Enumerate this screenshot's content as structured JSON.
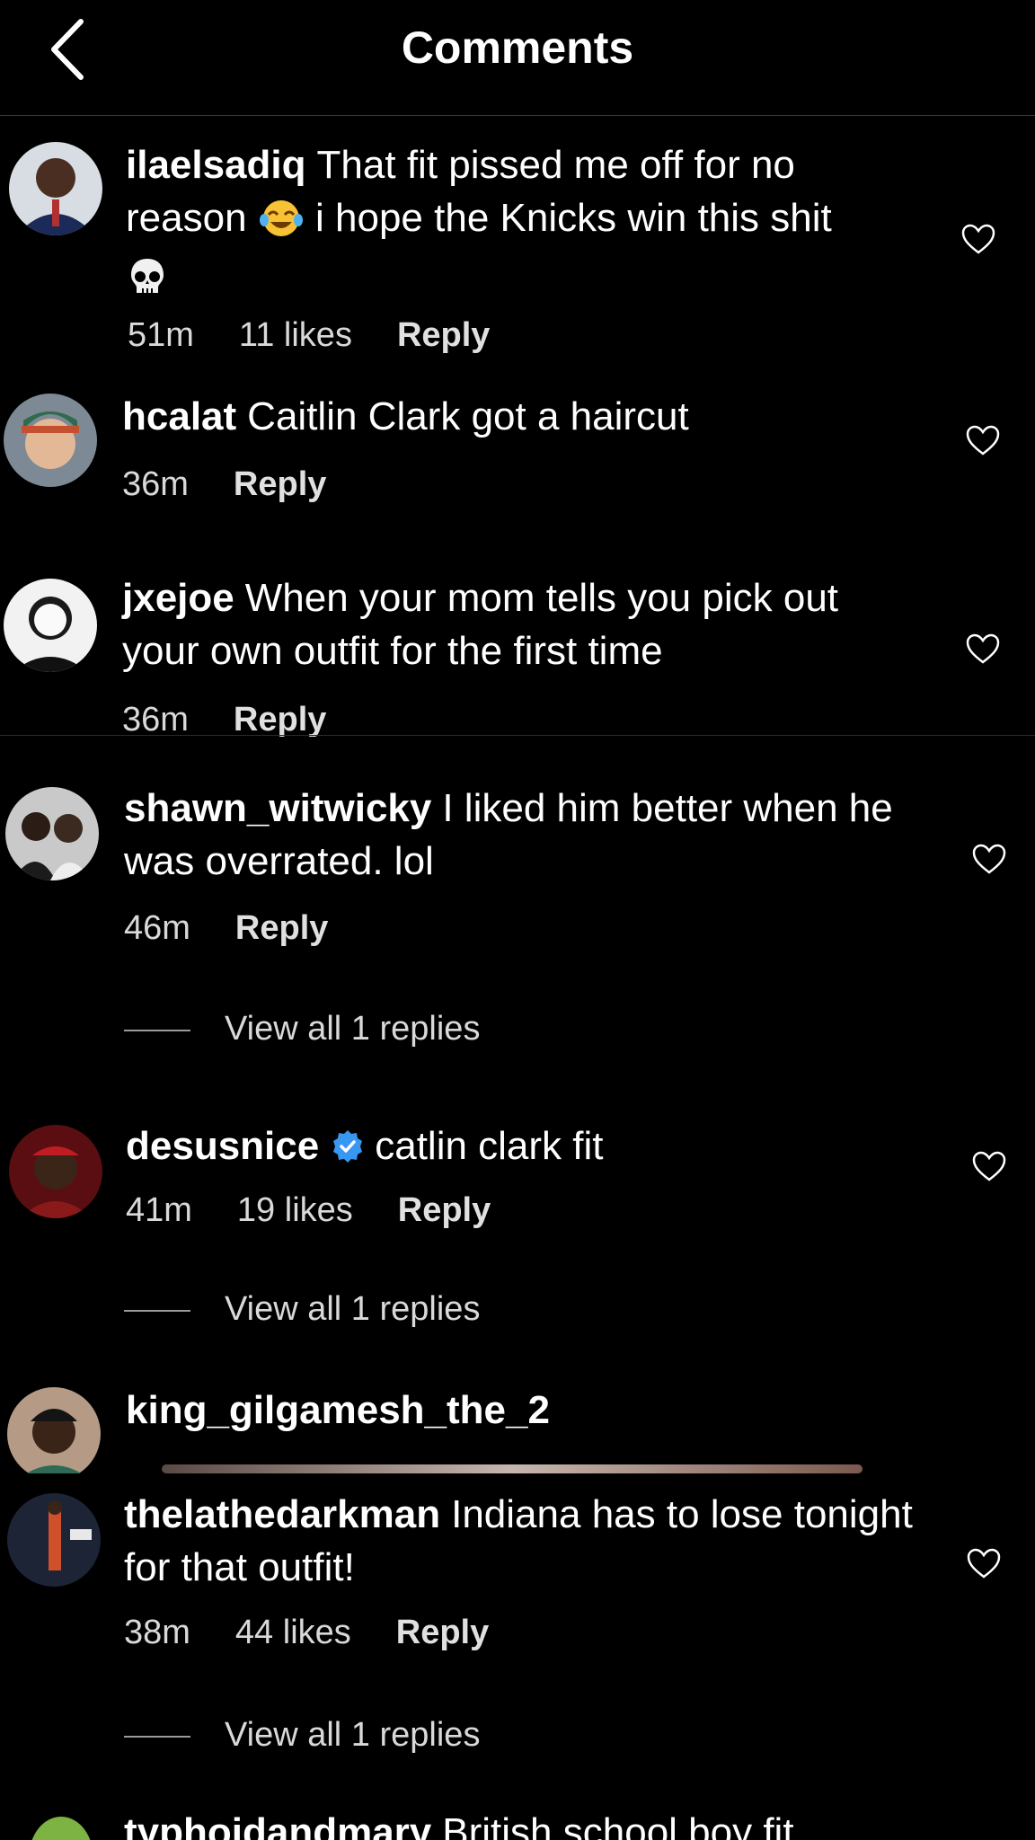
{
  "header": {
    "title": "Comments"
  },
  "comments": [
    {
      "username": "ilaelsadiq",
      "text": "That fit pissed me off for no reason",
      "text2": "i hope the Knicks win this shit",
      "time": "51m",
      "likes": "11 likes",
      "reply": "Reply"
    },
    {
      "username": "hcalat",
      "text": "Caitlin Clark got a haircut",
      "time": "36m",
      "reply": "Reply"
    },
    {
      "username": "jxejoe",
      "text": "When your mom tells you pick out your own outfit for the first time",
      "time": "36m",
      "reply": "Reply"
    },
    {
      "username": "shawn_witwicky",
      "text": "I liked him better when he was overrated. lol",
      "time": "46m",
      "reply": "Reply",
      "view_replies": "View all 1 replies"
    },
    {
      "username": "desusnice",
      "text": "catlin clark fit",
      "time": "41m",
      "likes": "19 likes",
      "reply": "Reply",
      "view_replies": "View all 1 replies"
    },
    {
      "username": "king_gilgamesh_the_2"
    },
    {
      "username": "thelathedarkman",
      "text": "Indiana has to lose tonight for that outfit!",
      "time": "38m",
      "likes": "44 likes",
      "reply": "Reply",
      "view_replies": "View all 1 replies"
    },
    {
      "username": "typhoidandmary",
      "text": "British school boy fit"
    }
  ],
  "colors": {
    "background": "#000000",
    "text": "#ffffff",
    "meta": "#d9d9d9",
    "verified": "#3897f0"
  }
}
